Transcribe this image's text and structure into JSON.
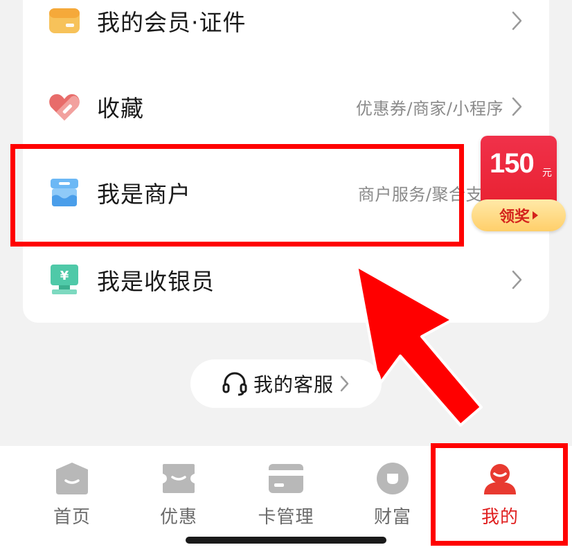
{
  "menu": {
    "items": [
      {
        "label": "我的会员·证件",
        "sub": "",
        "icon": "member-card-icon",
        "color": "#f5b041"
      },
      {
        "label": "收藏",
        "sub": "优惠券/商家/小程序",
        "icon": "heart-tag-icon",
        "color": "#e8605a"
      },
      {
        "label": "我是商户",
        "sub": "商户服务/聚合支",
        "icon": "store-icon",
        "color": "#5aa9f0"
      },
      {
        "label": "我是收银员",
        "sub": "",
        "icon": "cashier-icon",
        "color": "#3fc1a0"
      }
    ]
  },
  "promo": {
    "amount": "150",
    "unit": "元",
    "button_label": "领奖"
  },
  "service": {
    "label": "我的客服"
  },
  "tabbar": {
    "tabs": [
      {
        "label": "首页",
        "icon": "home-icon",
        "active": false
      },
      {
        "label": "优惠",
        "icon": "coupon-icon",
        "active": false
      },
      {
        "label": "卡管理",
        "icon": "card-icon",
        "active": false
      },
      {
        "label": "财富",
        "icon": "wealth-icon",
        "active": false
      },
      {
        "label": "我的",
        "icon": "profile-icon",
        "active": true
      }
    ]
  },
  "colors": {
    "accent_red": "#e02020",
    "annotation_red": "#ff0000",
    "inactive_icon": "#b8b8b8"
  }
}
